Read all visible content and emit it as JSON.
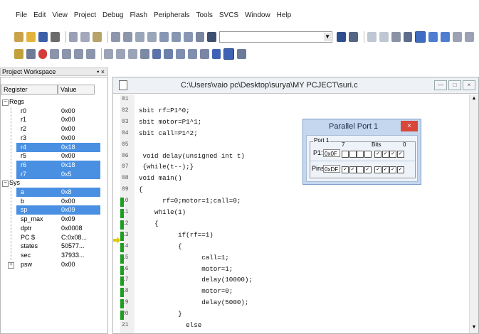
{
  "menu": [
    "File",
    "Edit",
    "View",
    "Project",
    "Debug",
    "Flash",
    "Peripherals",
    "Tools",
    "SVCS",
    "Window",
    "Help"
  ],
  "workspace": {
    "title": "Project Workspace",
    "pin": "• ×",
    "col_register": "Register",
    "col_value": "Value",
    "rows": [
      {
        "name": "Regs",
        "value": "",
        "level": 0,
        "expander": "−",
        "selected": false
      },
      {
        "name": "r0",
        "value": "0x00",
        "level": 1,
        "selected": false
      },
      {
        "name": "r1",
        "value": "0x00",
        "level": 1,
        "selected": false
      },
      {
        "name": "r2",
        "value": "0x00",
        "level": 1,
        "selected": false
      },
      {
        "name": "r3",
        "value": "0x00",
        "level": 1,
        "selected": false
      },
      {
        "name": "r4",
        "value": "0x18",
        "level": 1,
        "selected": true
      },
      {
        "name": "r5",
        "value": "0x00",
        "level": 1,
        "selected": false
      },
      {
        "name": "r6",
        "value": "0x18",
        "level": 1,
        "selected": true
      },
      {
        "name": "r7",
        "value": "0x5",
        "level": 1,
        "selected": true
      },
      {
        "name": "Sys",
        "value": "",
        "level": 0,
        "expander": "−",
        "selected": false
      },
      {
        "name": "a",
        "value": "0x8",
        "level": 1,
        "selected": true
      },
      {
        "name": "b",
        "value": "0x00",
        "level": 1,
        "selected": false
      },
      {
        "name": "sp",
        "value": "0x09",
        "level": 1,
        "selected": true
      },
      {
        "name": "sp_max",
        "value": "0x09",
        "level": 1,
        "selected": false
      },
      {
        "name": "dptr",
        "value": "0x0008",
        "level": 1,
        "selected": false
      },
      {
        "name": "PC $",
        "value": "C:0x08...",
        "level": 1,
        "selected": false
      },
      {
        "name": "states",
        "value": "50577...",
        "level": 1,
        "selected": false
      },
      {
        "name": "sec",
        "value": "37933...",
        "level": 1,
        "selected": false
      },
      {
        "name": "psw",
        "value": "0x00",
        "level": 1,
        "expander": "+",
        "selected": false
      }
    ]
  },
  "editor": {
    "title": "C:\\Users\\vaio pc\\Desktop\\surya\\MY PCJECT\\suri.c",
    "line_numbers": [
      "01",
      "02",
      "03",
      "04",
      "05",
      "06",
      "07",
      "08",
      "09",
      "10",
      "11",
      "12",
      "13",
      "14",
      "15",
      "16",
      "17",
      "18",
      "19",
      "20",
      "21"
    ],
    "lines": [
      "",
      "sbit rf=P1^0;",
      "sbit motor=P1^1;",
      "sbit call=P1^2;",
      "",
      " void delay(unsigned int t)",
      " {while(t--);}",
      "void main()",
      "{",
      "      rf=0;motor=1;call=0;",
      "    while(1)",
      "    {",
      "          if(rf==1)",
      "          {",
      "                call=1;",
      "                motor=1;",
      "                delay(10000);",
      "                motor=0;",
      "                delay(5000);",
      "          }",
      "            else"
    ]
  },
  "parallel_port": {
    "title": "Parallel Port 1",
    "close": "×",
    "group_label": "Port 1",
    "p_label": "P1:",
    "p_value": "0x0F",
    "pins_label": "Pins:",
    "pins_value": "0xDF",
    "bit_high": "7",
    "bits_label": "Bits",
    "bit_low": "0",
    "p_bits": [
      false,
      false,
      false,
      false,
      true,
      true,
      true,
      true
    ],
    "pin_bits": [
      true,
      true,
      false,
      true,
      true,
      true,
      true,
      true
    ]
  }
}
